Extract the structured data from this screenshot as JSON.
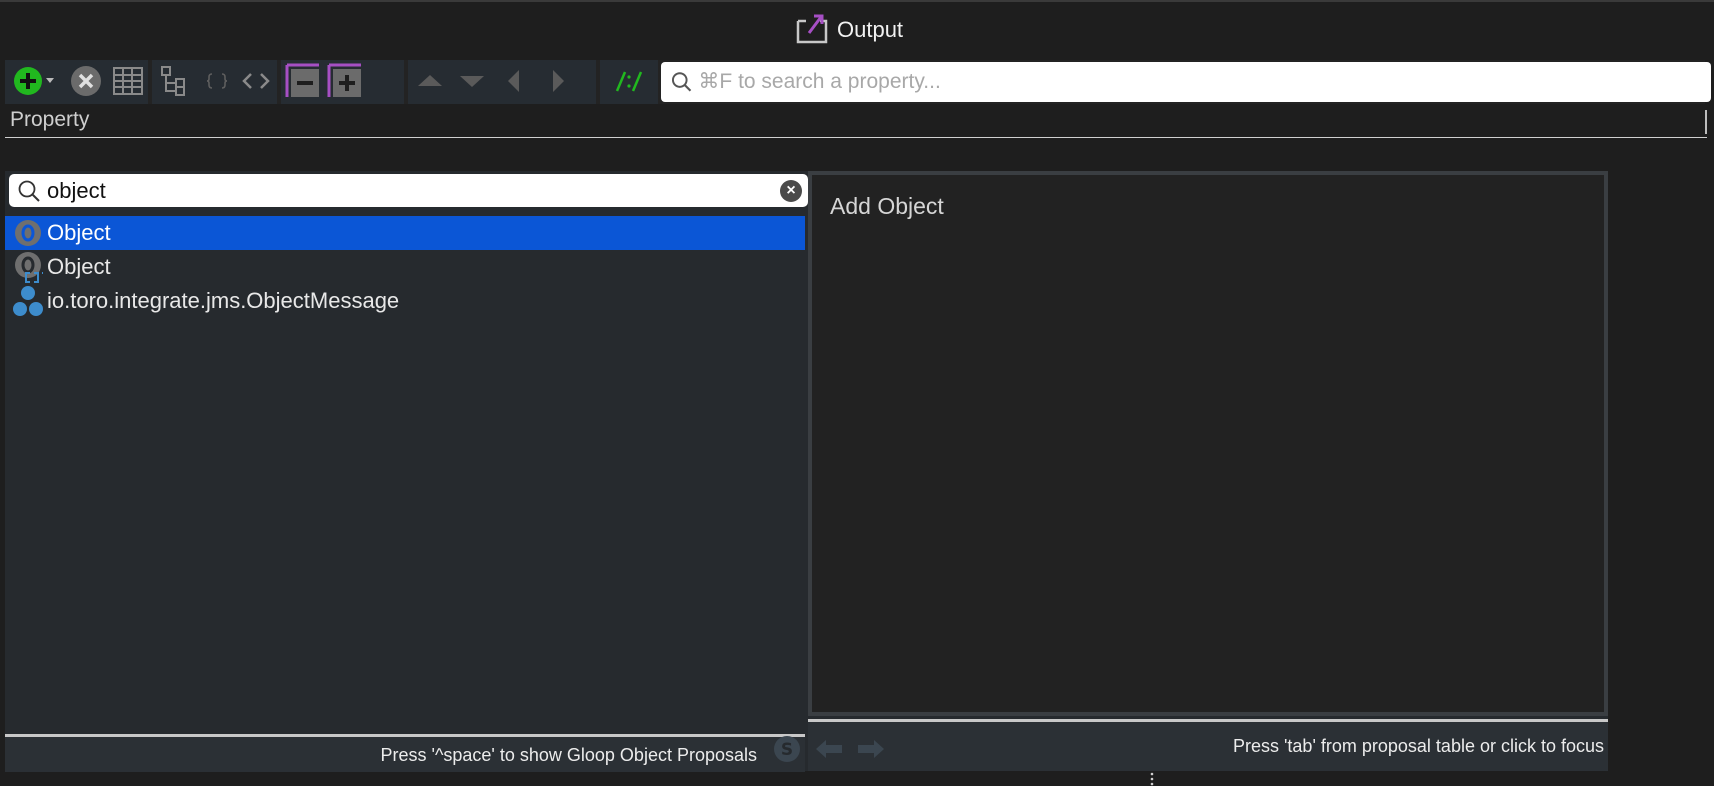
{
  "window": {
    "title": "Output"
  },
  "toolbar": {
    "search_placeholder": "⌘F to search a property..."
  },
  "property_header": {
    "label": "Property"
  },
  "popup": {
    "search_value": "object",
    "items": [
      {
        "label": "Object",
        "icon": "object-icon",
        "selected": true
      },
      {
        "label": "Object",
        "icon": "object-array-icon",
        "selected": false
      },
      {
        "label": "io.toro.integrate.jms.ObjectMessage",
        "icon": "model-icon",
        "selected": false
      }
    ],
    "list_hint": "Press '^space' to show Gloop Object Proposals",
    "detail_title": "Add Object",
    "detail_hint": "Press 'tab' from proposal table or click to focus"
  },
  "colors": {
    "selection": "#0b56d6",
    "add_green": "#21b81f",
    "accent_purple": "#a64fc4",
    "icon_blue": "#3d8ccc"
  }
}
